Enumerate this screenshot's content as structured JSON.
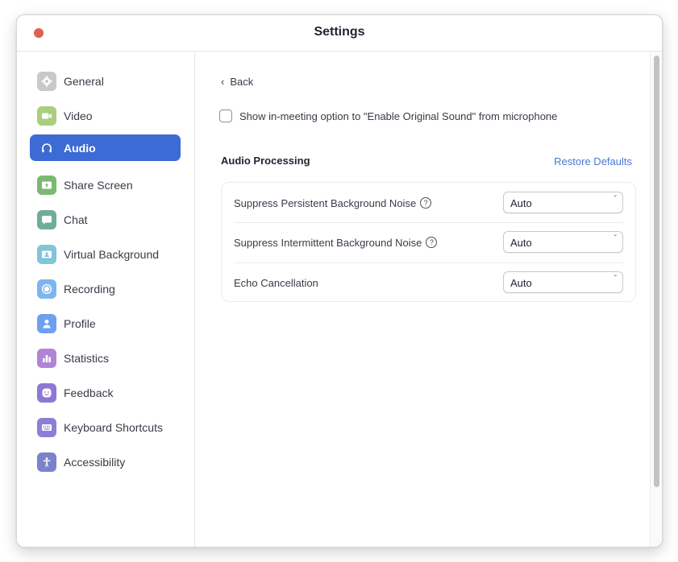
{
  "window": {
    "title": "Settings"
  },
  "sidebar": {
    "active": "Audio",
    "items": [
      {
        "label": "General",
        "icon": "gear-icon",
        "color": "#c9c9cc"
      },
      {
        "label": "Video",
        "icon": "video-camera-icon",
        "color": "#a9cf7e"
      },
      {
        "label": "Audio",
        "icon": "headphones-icon",
        "color": "#3c6bd6"
      },
      {
        "label": "Share Screen",
        "icon": "share-screen-icon",
        "color": "#7bb972"
      },
      {
        "label": "Chat",
        "icon": "chat-bubble-icon",
        "color": "#6fac9b"
      },
      {
        "label": "Virtual Background",
        "icon": "virtual-background-icon",
        "color": "#82c4d8"
      },
      {
        "label": "Recording",
        "icon": "recording-icon",
        "color": "#7db6ec"
      },
      {
        "label": "Profile",
        "icon": "profile-icon",
        "color": "#6f9ff0"
      },
      {
        "label": "Statistics",
        "icon": "statistics-icon",
        "color": "#b184d6"
      },
      {
        "label": "Feedback",
        "icon": "feedback-smiley-icon",
        "color": "#8f78d4"
      },
      {
        "label": "Keyboard Shortcuts",
        "icon": "keyboard-icon",
        "color": "#8b80d6"
      },
      {
        "label": "Accessibility",
        "icon": "accessibility-icon",
        "color": "#7a83c9"
      }
    ]
  },
  "content": {
    "back_label": "Back",
    "original_sound": {
      "label": "Show in-meeting option to \"Enable Original Sound\" from microphone",
      "checked": false
    },
    "section_title": "Audio Processing",
    "restore_label": "Restore Defaults",
    "accent_color": "#4a78d4",
    "rows": [
      {
        "label": "Suppress Persistent Background Noise",
        "has_help": true,
        "value": "Auto"
      },
      {
        "label": "Suppress Intermittent Background Noise",
        "has_help": true,
        "value": "Auto"
      },
      {
        "label": "Echo Cancellation",
        "has_help": false,
        "value": "Auto"
      }
    ],
    "help_glyph": "?"
  }
}
